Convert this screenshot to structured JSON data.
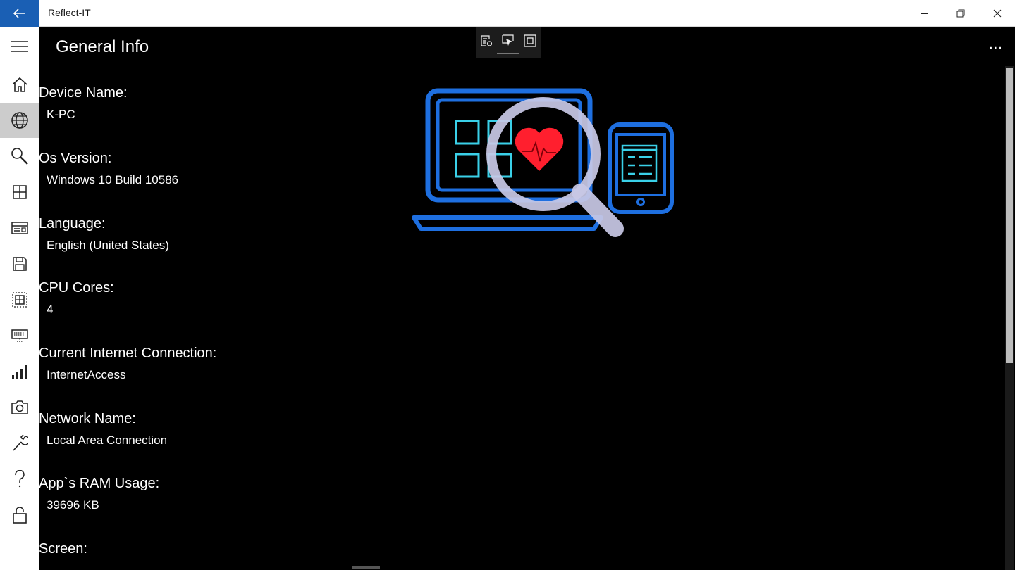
{
  "app": {
    "title": "Reflect-IT"
  },
  "page": {
    "title": "General Info",
    "more_label": "..."
  },
  "sidebar": {
    "items": [
      {
        "name": "hamburger-menu-icon",
        "selected": false
      },
      {
        "name": "home-icon",
        "selected": false
      },
      {
        "name": "globe-icon",
        "selected": true
      },
      {
        "name": "search-icon",
        "selected": false
      },
      {
        "name": "apps-grid-icon",
        "selected": false
      },
      {
        "name": "devices-icon",
        "selected": false
      },
      {
        "name": "storage-icon",
        "selected": false
      },
      {
        "name": "processor-icon",
        "selected": false
      },
      {
        "name": "display-icon",
        "selected": false
      },
      {
        "name": "network-signal-icon",
        "selected": false
      },
      {
        "name": "camera-icon",
        "selected": false
      },
      {
        "name": "tools-icon",
        "selected": false
      },
      {
        "name": "help-icon",
        "selected": false
      },
      {
        "name": "lock-icon",
        "selected": false
      }
    ]
  },
  "info": [
    {
      "label": "Device Name:",
      "value": "K-PC"
    },
    {
      "label": "Os Version:",
      "value": "Windows 10 Build 10586"
    },
    {
      "label": "Language:",
      "value": "English (United States)"
    },
    {
      "label": "CPU Cores:",
      "value": "4"
    },
    {
      "label": "Current Internet Connection:",
      "value": "InternetAccess"
    },
    {
      "label": "Network Name:",
      "value": "Local Area Connection"
    },
    {
      "label": "App`s RAM Usage:",
      "value": "39696 KB"
    },
    {
      "label": "Screen:",
      "value": ""
    }
  ],
  "colors": {
    "accent": "#1a5fb4",
    "hero_blue": "#1e6fe0",
    "hero_cyan": "#3ad0e8",
    "heart_red": "#ff1f2e",
    "magnifier": "#c9c9e6"
  }
}
